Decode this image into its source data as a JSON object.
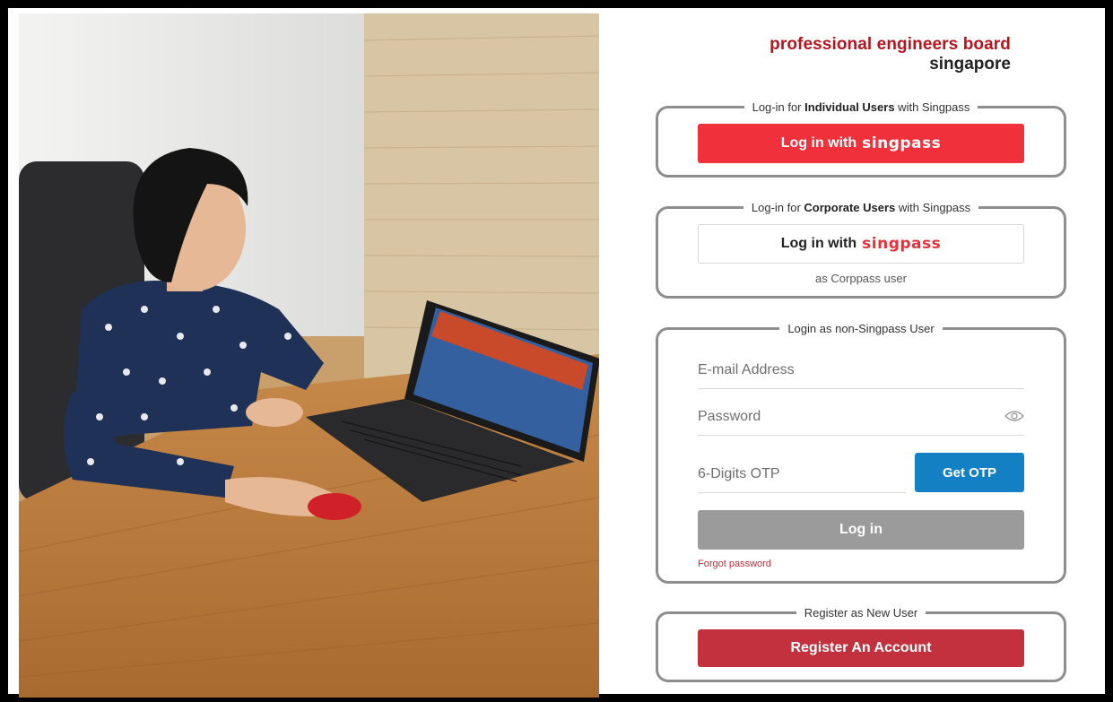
{
  "brand": {
    "line1": "professional engineers board",
    "line2": "singapore"
  },
  "individual": {
    "legend_prefix": "Log-in for ",
    "legend_bold": "Individual Users",
    "legend_suffix": " with Singpass",
    "button_prefix": "Log in with",
    "button_brand": "singpass"
  },
  "corporate": {
    "legend_prefix": "Log-in for ",
    "legend_bold": "Corporate Users",
    "legend_suffix": " with Singpass",
    "button_prefix": "Log in with",
    "button_brand": "singpass",
    "sub_text": "as Corppass user"
  },
  "non_singpass": {
    "legend": "Login as non-Singpass User",
    "email_placeholder": "E-mail Address",
    "password_placeholder": "Password",
    "otp_placeholder": "6-Digits OTP",
    "get_otp_label": "Get OTP",
    "login_label": "Log in",
    "forgot_label": "Forgot password"
  },
  "register": {
    "legend": "Register as New User",
    "button_label": "Register An Account"
  },
  "colors": {
    "brand_red": "#b8141d",
    "singpass_red": "#f0313b",
    "otp_blue": "#1480c4",
    "login_gray": "#9b9b9b",
    "register_red": "#c2313d"
  }
}
